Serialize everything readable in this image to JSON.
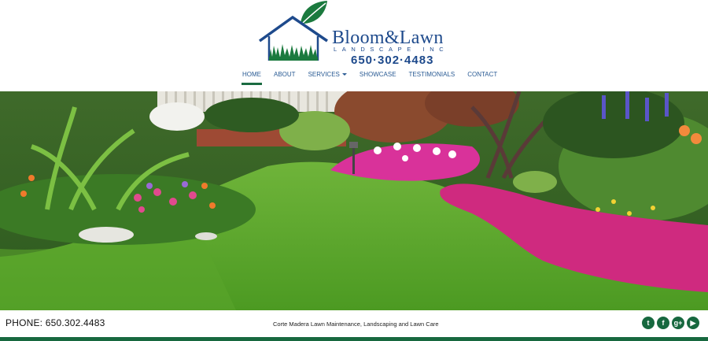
{
  "brand": {
    "name": "Bloom&Lawn",
    "subtitle": "LANDSCAPE INC",
    "phone": "650·302·4483",
    "colors": {
      "blue": "#1e4a8c",
      "green": "#17683f",
      "leaf": "#1b7a3e"
    }
  },
  "nav": {
    "items": [
      {
        "label": "HOME",
        "active": true
      },
      {
        "label": "ABOUT"
      },
      {
        "label": "SERVICES",
        "has_dropdown": true
      },
      {
        "label": "SHOWCASE"
      },
      {
        "label": "TESTIMONIALS"
      },
      {
        "label": "CONTACT"
      }
    ]
  },
  "footer": {
    "phone": "PHONE: 650.302.4483",
    "tagline": "Corte Madera Lawn Maintenance, Landscaping and Lawn Care",
    "socials": [
      {
        "icon": "twitter-icon",
        "glyph": "t"
      },
      {
        "icon": "facebook-icon",
        "glyph": "f"
      },
      {
        "icon": "google-plus-icon",
        "glyph": "g+"
      },
      {
        "icon": "youtube-icon",
        "glyph": "▶"
      }
    ]
  }
}
